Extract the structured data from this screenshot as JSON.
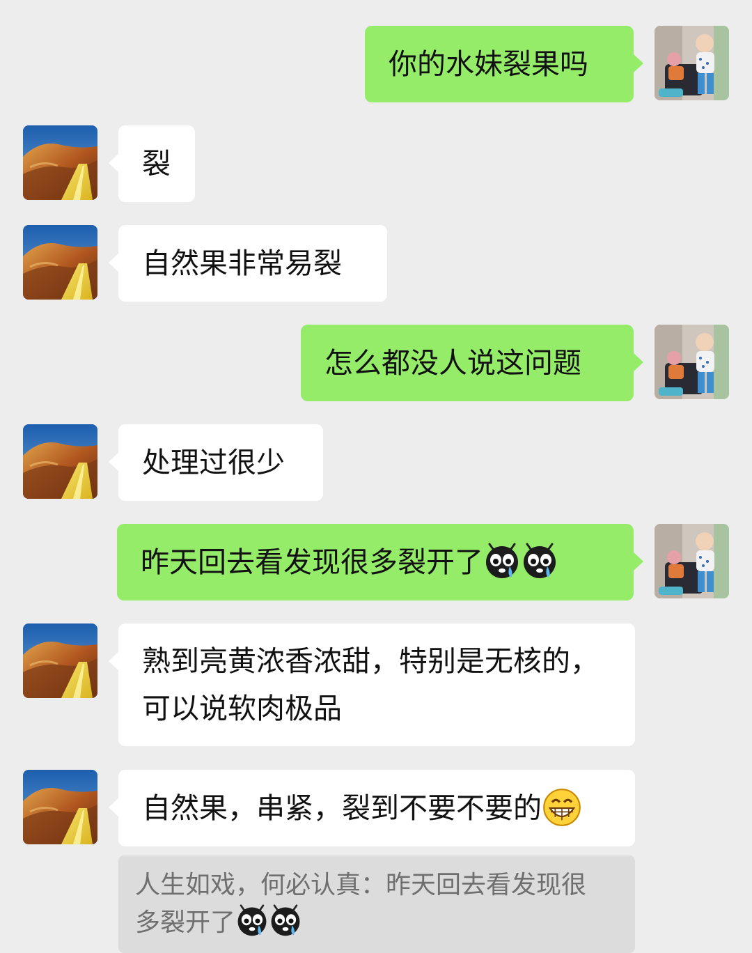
{
  "colors": {
    "background": "#ededed",
    "outgoing_bubble": "#95ec69",
    "incoming_bubble": "#ffffff",
    "quote_bubble": "#dcdcdc",
    "quote_text": "#6f6f6f"
  },
  "messages": [
    {
      "direction": "outgoing",
      "avatar": "child-photo-avatar",
      "lines": [
        "你的水妹裂果吗"
      ]
    },
    {
      "direction": "incoming",
      "avatar": "desert-road-avatar",
      "lines": [
        "裂"
      ]
    },
    {
      "direction": "incoming",
      "avatar": "desert-road-avatar",
      "lines": [
        "自然果非常易裂"
      ]
    },
    {
      "direction": "outgoing",
      "avatar": "child-photo-avatar",
      "lines": [
        "怎么都没人说这问题"
      ]
    },
    {
      "direction": "incoming",
      "avatar": "desert-road-avatar",
      "lines": [
        "处理过很少"
      ]
    },
    {
      "direction": "outgoing",
      "avatar": "child-photo-avatar",
      "lines": [
        "昨天回去看发现很多裂开了"
      ],
      "emojis": [
        "crying-face-icon",
        "crying-face-icon"
      ]
    },
    {
      "direction": "incoming",
      "avatar": "desert-road-avatar",
      "lines": [
        "熟到亮黄浓香浓甜，特别是无核的，",
        "可以说软肉极品"
      ]
    },
    {
      "direction": "incoming",
      "avatar": "desert-road-avatar",
      "lines": [
        "自然果，串紧，裂到不要不要的"
      ],
      "emojis": [
        "grinning-face-icon"
      ]
    }
  ],
  "quote": {
    "lines": [
      "人生如戏，何必认真：昨天回去看发现很",
      "多裂开了"
    ],
    "emojis": [
      "crying-face-icon",
      "crying-face-icon"
    ]
  }
}
